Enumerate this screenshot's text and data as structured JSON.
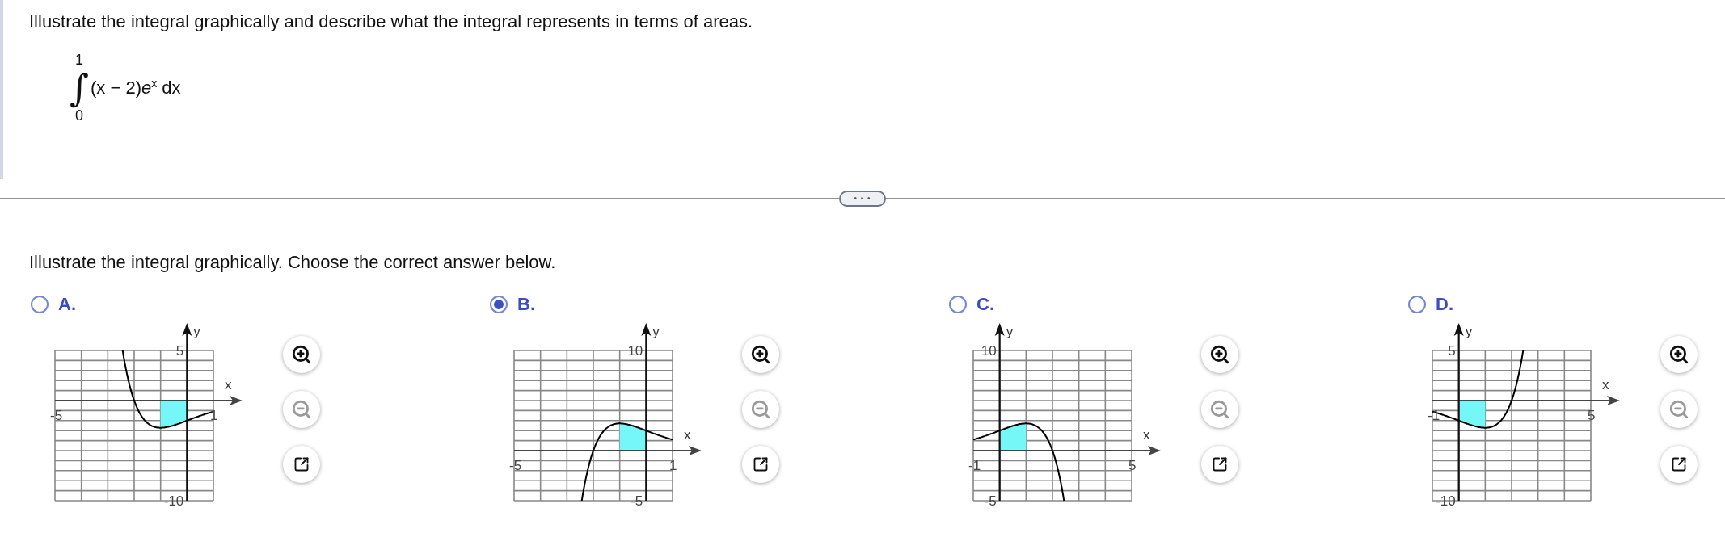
{
  "question": {
    "text": "Illustrate the integral graphically and describe what the integral represents in terms of areas.",
    "integral": {
      "upper": "1",
      "sign": "∫",
      "integrand": "(x − 2)*e*$^{x}$ dx",
      "lower": "0"
    }
  },
  "divider": {
    "label": "• • •"
  },
  "prompt": "Illustrate the integral graphically. Choose the correct answer below.",
  "options": [
    {
      "letter": "A.",
      "selected": false,
      "graph": {
        "kind": "mirror",
        "x_axis": "x",
        "y_axis": "y",
        "x_min": "-5",
        "x_max": "1",
        "y_min": "-10",
        "y_max": "5"
      },
      "buttons": [
        {
          "kind": "zoom_in",
          "disabled": false
        },
        {
          "kind": "zoom_out",
          "disabled": true
        },
        {
          "kind": "popout",
          "disabled": false
        }
      ]
    },
    {
      "letter": "B.",
      "selected": true,
      "graph": {
        "kind": "mirror_negated",
        "x_axis": "x",
        "y_axis": "y",
        "x_min": "-5",
        "x_max": "1",
        "y_min": "-5",
        "y_max": "10"
      },
      "buttons": [
        {
          "kind": "zoom_in",
          "disabled": false
        },
        {
          "kind": "zoom_out",
          "disabled": true
        },
        {
          "kind": "popout",
          "disabled": false
        }
      ]
    },
    {
      "letter": "C.",
      "selected": false,
      "graph": {
        "kind": "negated",
        "x_axis": "x",
        "y_axis": "y",
        "x_min": "-1",
        "x_max": "5",
        "y_min": "-5",
        "y_max": "10"
      },
      "buttons": [
        {
          "kind": "zoom_in",
          "disabled": false
        },
        {
          "kind": "zoom_out",
          "disabled": true
        },
        {
          "kind": "popout",
          "disabled": false
        }
      ]
    },
    {
      "letter": "D.",
      "selected": false,
      "graph": {
        "kind": "original",
        "x_axis": "x",
        "y_axis": "y",
        "x_min": "-1",
        "x_max": "5",
        "y_min": "-10",
        "y_max": "5"
      },
      "buttons": [
        {
          "kind": "zoom_in",
          "disabled": false
        },
        {
          "kind": "zoom_out",
          "disabled": true
        },
        {
          "kind": "popout",
          "disabled": false
        }
      ]
    }
  ]
}
